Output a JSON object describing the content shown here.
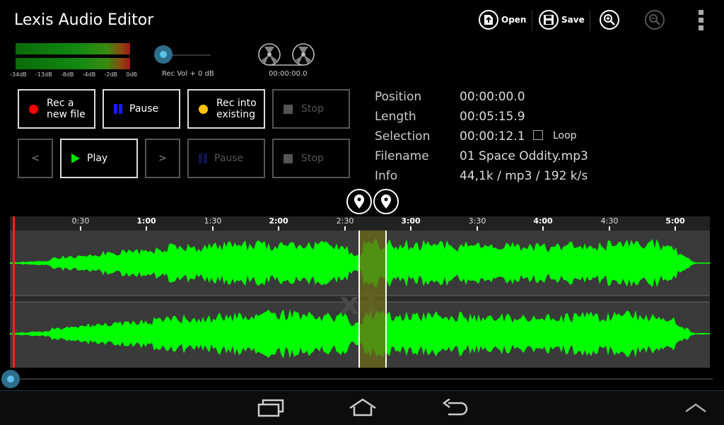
{
  "app": {
    "title": "Lexis Audio Editor"
  },
  "toolbar": {
    "open_label": "Open",
    "save_label": "Save",
    "zoom_in_icon": "zoom-in-icon",
    "zoom_out_icon": "zoom-out-icon",
    "menu_icon": "overflow-menu-icon"
  },
  "meters": {
    "scale": [
      "-34dB",
      "-13dB",
      "-8dB",
      "-4dB",
      "-2dB",
      "0dB"
    ]
  },
  "rec_vol": {
    "label": "Rec Vol + 0 dB",
    "level": 0.0
  },
  "tape": {
    "time": "00:00:00.0"
  },
  "record_buttons": {
    "rec_new": "Rec a new file",
    "rec_new_l1": "Rec a",
    "rec_new_l2": "new file",
    "pause": "Pause",
    "rec_existing_l1": "Rec into",
    "rec_existing_l2": "existing",
    "stop": "Stop"
  },
  "play_buttons": {
    "prev": "<",
    "play": "Play",
    "next": ">",
    "pause": "Pause",
    "stop": "Stop"
  },
  "info": {
    "position_label": "Position",
    "position_value": "00:00:00.0",
    "length_label": "Length",
    "length_value": "00:05:15.9",
    "selection_label": "Selection",
    "selection_value": "00:00:12.1",
    "loop_label": "Loop",
    "loop_checked": false,
    "filename_label": "Filename",
    "filename_value": "01 Space Oddity.mp3",
    "info_label": "Info",
    "info_value": "44,1k / mp3 / 192 k/s"
  },
  "timeline": {
    "labels": [
      "0:30",
      "1:00",
      "1:30",
      "2:00",
      "2:30",
      "3:00",
      "3:30",
      "4:00",
      "4:30",
      "5:00"
    ],
    "zoom_watermark": "x1"
  },
  "scrubber": {
    "position": 0.0
  },
  "colors": {
    "waveform": "#00ff00",
    "selection": "#6b6b1a",
    "playhead": "#ff2020",
    "accent": "#5ec0e8"
  },
  "nav": {
    "recents_icon": "recent-apps-icon",
    "home_icon": "home-icon",
    "back_icon": "back-icon",
    "up_icon": "chevron-up-icon"
  }
}
